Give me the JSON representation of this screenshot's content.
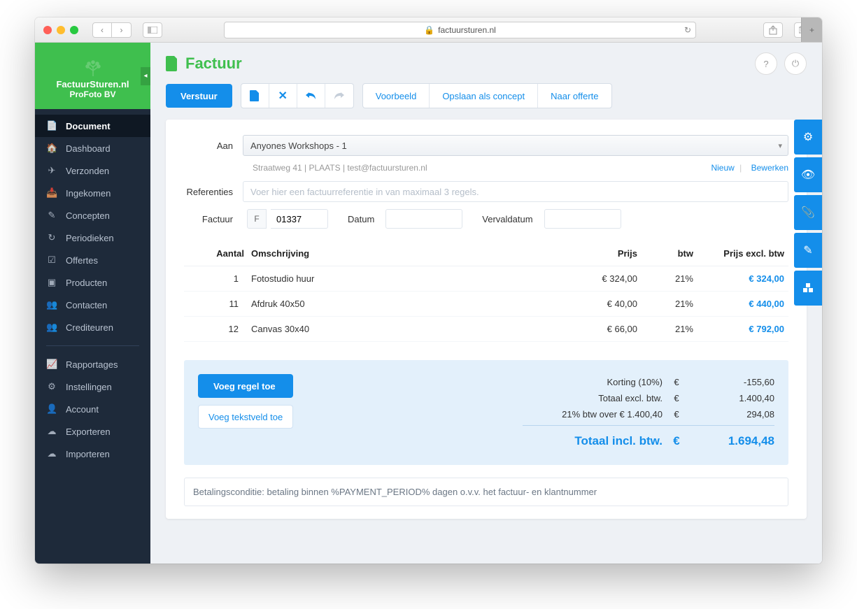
{
  "browser": {
    "url_host": "factuursturen.nl"
  },
  "brand": {
    "name": "FactuurSturen.nl",
    "company": "ProFoto BV"
  },
  "sidebar": {
    "items": [
      {
        "label": "Document",
        "icon": "file-icon",
        "active": true
      },
      {
        "label": "Dashboard",
        "icon": "home-icon"
      },
      {
        "label": "Verzonden",
        "icon": "send-icon"
      },
      {
        "label": "Ingekomen",
        "icon": "inbox-icon"
      },
      {
        "label": "Concepten",
        "icon": "edit-icon"
      },
      {
        "label": "Periodieken",
        "icon": "refresh-icon"
      },
      {
        "label": "Offertes",
        "icon": "check-icon"
      },
      {
        "label": "Producten",
        "icon": "cubes-icon"
      },
      {
        "label": "Contacten",
        "icon": "users-icon"
      },
      {
        "label": "Crediteuren",
        "icon": "users-icon"
      }
    ],
    "items2": [
      {
        "label": "Rapportages",
        "icon": "chart-icon"
      },
      {
        "label": "Instellingen",
        "icon": "cogs-icon"
      },
      {
        "label": "Account",
        "icon": "user-icon"
      },
      {
        "label": "Exporteren",
        "icon": "cloud-down-icon"
      },
      {
        "label": "Importeren",
        "icon": "cloud-up-icon"
      }
    ]
  },
  "page": {
    "title": "Factuur"
  },
  "toolbar": {
    "send": "Verstuur",
    "links": {
      "voorbeeld": "Voorbeeld",
      "concept": "Opslaan als concept",
      "offerte": "Naar offerte"
    }
  },
  "form": {
    "aan_label": "Aan",
    "client": "Anyones Workshops - 1",
    "client_sub": "Straatweg 41 | PLAATS | test@factuursturen.nl",
    "nieuw": "Nieuw",
    "bewerken": "Bewerken",
    "ref_label": "Referenties",
    "ref_placeholder": "Voer hier een factuurreferentie in van maximaal 3 regels.",
    "factuur_label": "Factuur",
    "factuur_prefix": "F",
    "factuur_num": "01337",
    "datum_label": "Datum",
    "verval_label": "Vervaldatum"
  },
  "lines": {
    "head": {
      "aantal": "Aantal",
      "omschrijving": "Omschrijving",
      "prijs": "Prijs",
      "btw": "btw",
      "totaal": "Prijs excl. btw"
    },
    "rows": [
      {
        "qty": "1",
        "desc": "Fotostudio huur",
        "price": "€ 324,00",
        "btw": "21%",
        "total": "€ 324,00"
      },
      {
        "qty": "11",
        "desc": "Afdruk 40x50",
        "price": "€ 40,00",
        "btw": "21%",
        "total": "€ 440,00"
      },
      {
        "qty": "12",
        "desc": "Canvas 30x40",
        "price": "€ 66,00",
        "btw": "21%",
        "total": "€ 792,00"
      }
    ]
  },
  "totals": {
    "add_line": "Voeg regel toe",
    "add_text": "Voeg tekstveld toe",
    "rows": [
      {
        "lbl": "Korting (10%)",
        "cur": "€",
        "val": "-155,60"
      },
      {
        "lbl": "Totaal excl. btw.",
        "cur": "€",
        "val": "1.400,40"
      },
      {
        "lbl": "21% btw over € 1.400,40",
        "cur": "€",
        "val": "294,08"
      }
    ],
    "grand": {
      "lbl": "Totaal incl. btw.",
      "cur": "€",
      "val": "1.694,48"
    }
  },
  "note": "Betalingsconditie: betaling binnen %PAYMENT_PERIOD% dagen o.v.v. het factuur- en klantnummer"
}
